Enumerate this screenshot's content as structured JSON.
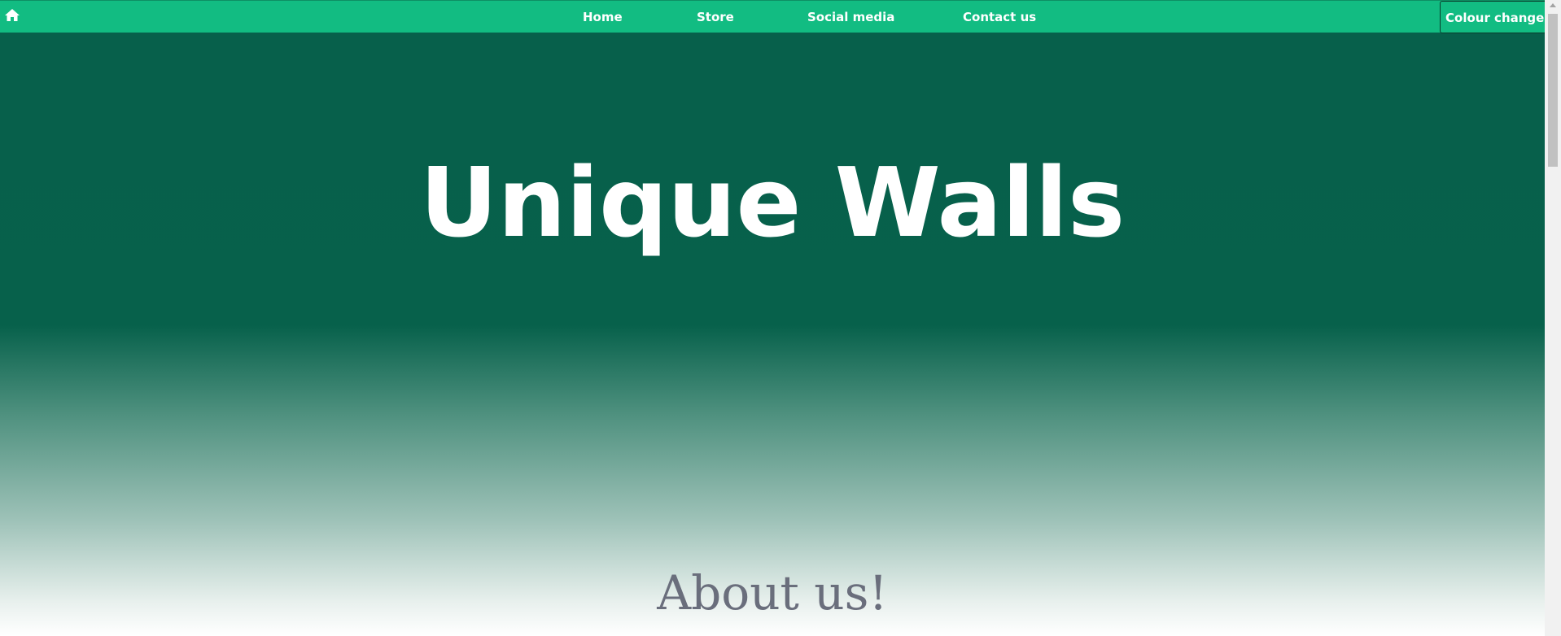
{
  "navbar": {
    "home_icon": "home-icon",
    "items": [
      {
        "label": "Home"
      },
      {
        "label": "Store"
      },
      {
        "label": "Social media"
      },
      {
        "label": "Contact us"
      }
    ],
    "colour_changer_label": "Colour changer"
  },
  "hero": {
    "title": "Unique Walls"
  },
  "about": {
    "title": "About us!"
  },
  "colors": {
    "navbar": "#12bc82",
    "hero_dark": "#07614b",
    "about_text": "#6a6e7c"
  }
}
